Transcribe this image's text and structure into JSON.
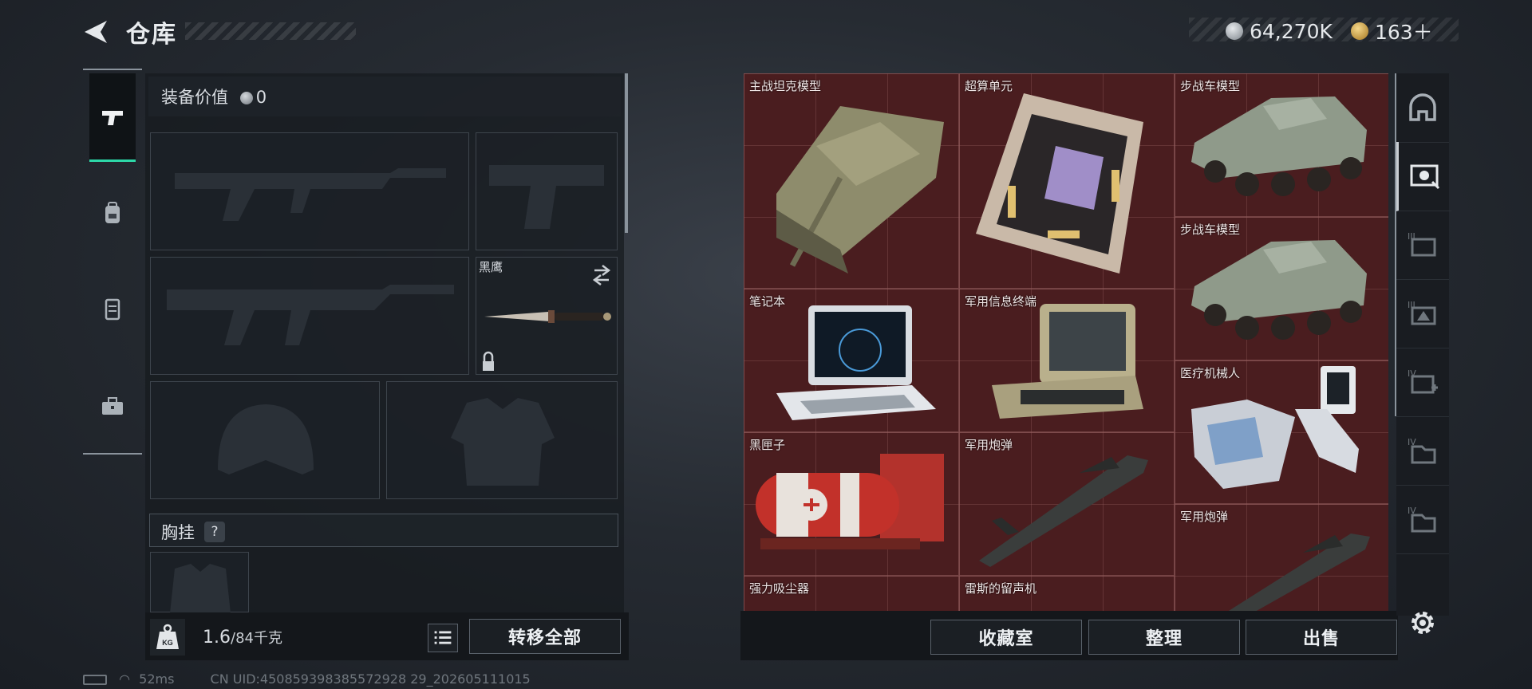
{
  "header": {
    "title": "仓库",
    "currency": [
      {
        "icon": "silver-coin-icon",
        "value": "64,270K",
        "color": "#b9bfc6"
      },
      {
        "icon": "gold-coin-icon",
        "value": "163＋",
        "color": "#d7a84a"
      }
    ]
  },
  "left_nav": [
    {
      "name": "weapon",
      "icon": "pistol-icon",
      "active": true
    },
    {
      "name": "armor",
      "icon": "backpack-icon",
      "active": false
    },
    {
      "name": "rig",
      "icon": "vest-icon",
      "active": false
    },
    {
      "name": "kit",
      "icon": "toolbox-icon",
      "active": false
    }
  ],
  "equipment": {
    "value_label": "装备价值",
    "value": "0",
    "knife_name": "黑鹰",
    "vest_label": "胸挂",
    "vest_help": "?",
    "weight_value": "1.6",
    "weight_unit": "/84千克",
    "transfer_all": "转移全部"
  },
  "storage_items": [
    {
      "label": "主战坦克模型"
    },
    {
      "label": "超算单元"
    },
    {
      "label": "步战车模型"
    },
    {
      "label": "步战车模型"
    },
    {
      "label": "笔记本"
    },
    {
      "label": "军用信息终端"
    },
    {
      "label": "医疗机械人"
    },
    {
      "label": "黑匣子"
    },
    {
      "label": "军用炮弹"
    },
    {
      "label": "军用炮弹"
    },
    {
      "label": "强力吸尘器"
    },
    {
      "label": "雷斯的留声机"
    }
  ],
  "storage_buttons": {
    "collection": "收藏室",
    "sort": "整理",
    "sell": "出售"
  },
  "right_tabs": [
    "helmet-tab-icon",
    "stash-tab-icon",
    "stash-3a-icon",
    "stash-3b-icon",
    "stash-4-add-icon",
    "stash-4-icon",
    "stash-4b-icon"
  ],
  "status": {
    "ping": "52ms",
    "uid": "CN UID:450859398385572928 29_202605111015"
  },
  "colors": {
    "accent": "#2dd8a8",
    "grid_bg": "#4a1d1f"
  }
}
